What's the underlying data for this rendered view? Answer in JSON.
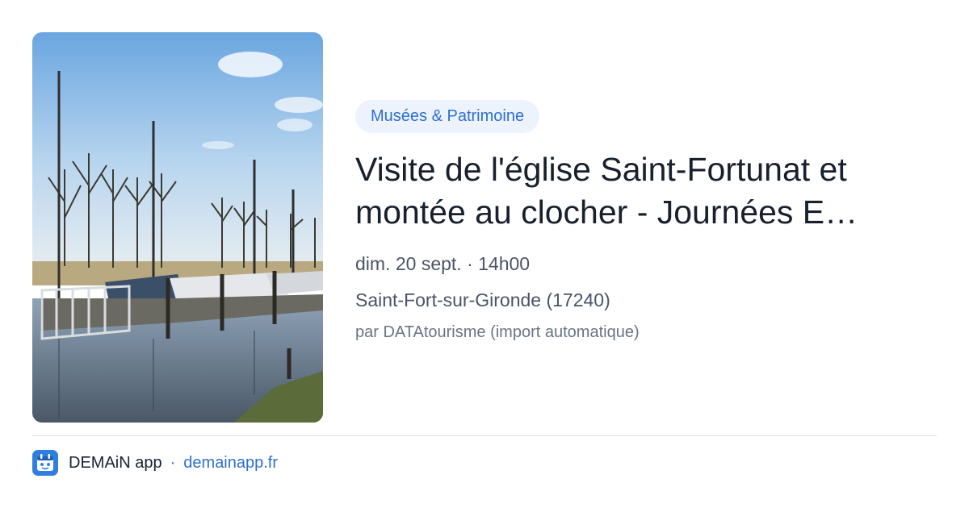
{
  "event": {
    "category": "Musées & Patrimoine",
    "title": "Visite de l'église Saint-Fortunat et montée au clocher - Journées E…",
    "datetime": "dim. 20 sept. · 14h00",
    "location": "Saint-Fort-sur-Gironde (17240)",
    "source": "par DATAtourisme (import automatique)"
  },
  "footer": {
    "app_name": "DEMAiN app",
    "separator": "·",
    "domain": "demainapp.fr"
  },
  "colors": {
    "accent": "#2e6fd1",
    "tag_bg": "#edf3fc",
    "title": "#18202e",
    "meta": "#4b5566"
  },
  "icons": {
    "app": "demain-app-icon",
    "photo": "marina-photo"
  }
}
